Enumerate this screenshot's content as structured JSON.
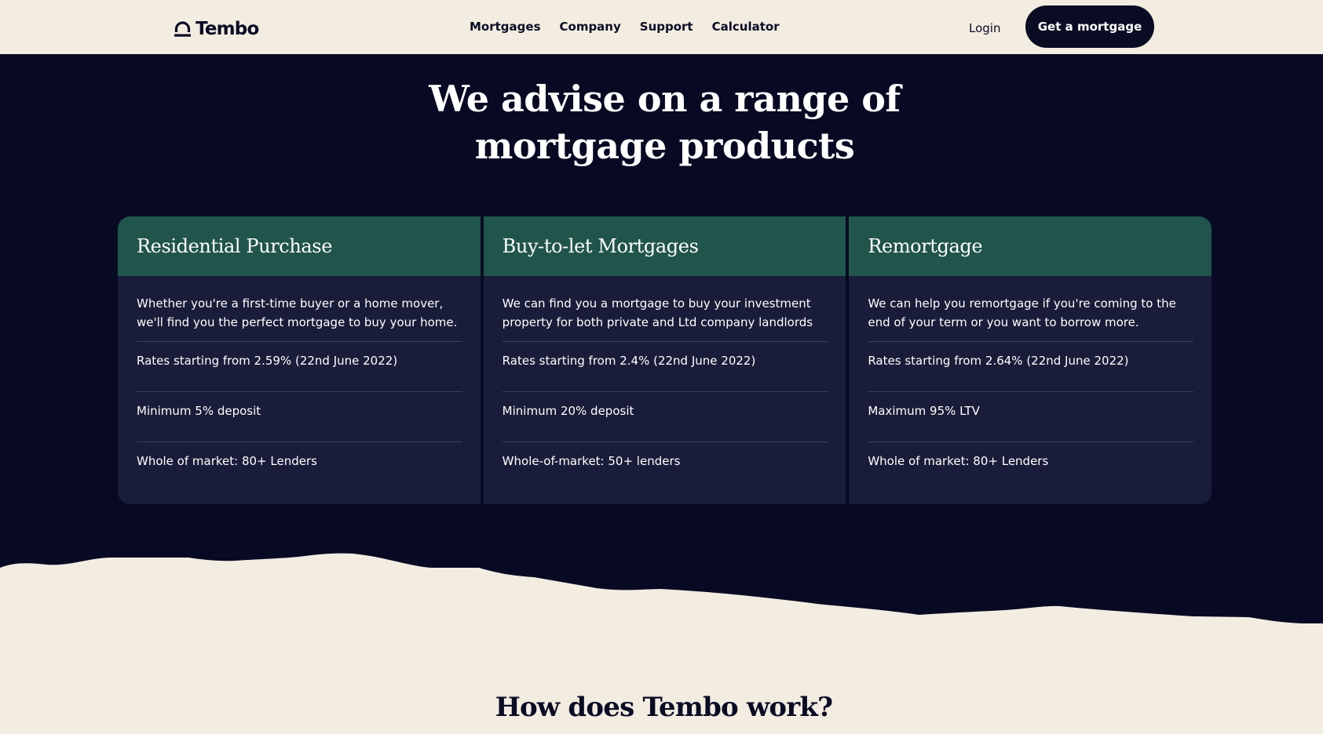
{
  "header": {
    "logo_text": "Tembo",
    "nav": [
      "Mortgages",
      "Company",
      "Support",
      "Calculator"
    ],
    "login_label": "Login",
    "cta_label": "Get a mortgage"
  },
  "products": {
    "title_line1": "We advise on a range of",
    "title_line2": "mortgage products",
    "cards": [
      {
        "title": "Residential Purchase",
        "description": "Whether you're a first-time buyer or a home mover, we'll find you the perfect mortgage to buy your home.",
        "rows": [
          "Rates starting from 2.59% (22nd June 2022)",
          "Minimum 5% deposit",
          "Whole of market: 80+ Lenders"
        ]
      },
      {
        "title": "Buy-to-let Mortgages",
        "description": "We can find you a mortgage to buy your investment property for both private and Ltd company landlords",
        "rows": [
          "Rates starting from 2.4% (22nd June 2022)",
          "Minimum 20% deposit",
          "Whole-of-market: 50+ lenders"
        ]
      },
      {
        "title": "Remortgage",
        "description": "We can help you remortgage if you're coming to the end of your term or you want to borrow more.",
        "rows": [
          "Rates starting from 2.64% (22nd June 2022)",
          "Maximum 95% LTV",
          "Whole of market: 80+ Lenders"
        ]
      }
    ]
  },
  "how": {
    "title": "How does Tembo work?"
  },
  "colors": {
    "dark_bg": "#080a24",
    "cream_bg": "#f2ece1",
    "card_header": "#21554c",
    "card_body": "#191d39"
  }
}
